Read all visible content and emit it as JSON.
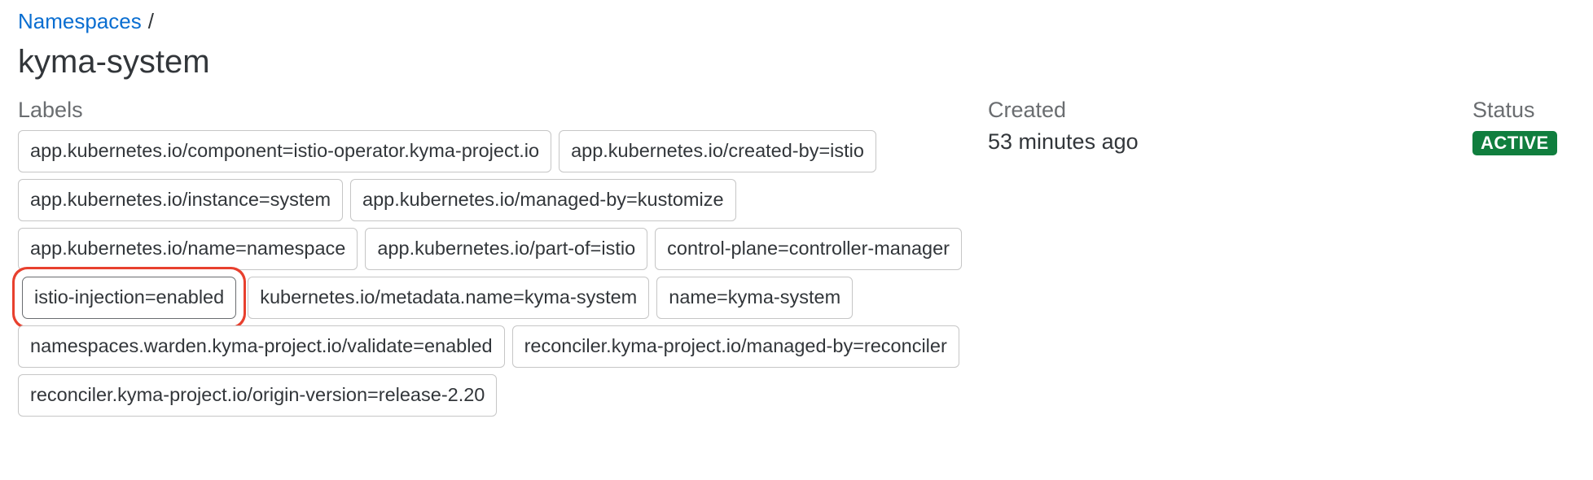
{
  "breadcrumb": {
    "parent_label": "Namespaces",
    "separator": "/"
  },
  "page": {
    "title": "kyma-system"
  },
  "labels": {
    "heading": "Labels",
    "items": [
      "app.kubernetes.io/component=istio-operator.kyma-project.io",
      "app.kubernetes.io/created-by=istio",
      "app.kubernetes.io/instance=system",
      "app.kubernetes.io/managed-by=kustomize",
      "app.kubernetes.io/name=namespace",
      "app.kubernetes.io/part-of=istio",
      "control-plane=controller-manager",
      "istio-injection=enabled",
      "kubernetes.io/metadata.name=kyma-system",
      "name=kyma-system",
      "namespaces.warden.kyma-project.io/validate=enabled",
      "reconciler.kyma-project.io/managed-by=reconciler",
      "reconciler.kyma-project.io/origin-version=release-2.20"
    ],
    "highlighted_item": "istio-injection=enabled"
  },
  "created": {
    "heading": "Created",
    "value": "53 minutes ago"
  },
  "status": {
    "heading": "Status",
    "value": "ACTIVE",
    "color": "#107e3e"
  },
  "colors": {
    "link": "#0a6ed1",
    "highlight_ring": "#e8402e",
    "tag_border": "#c6c6c6"
  }
}
